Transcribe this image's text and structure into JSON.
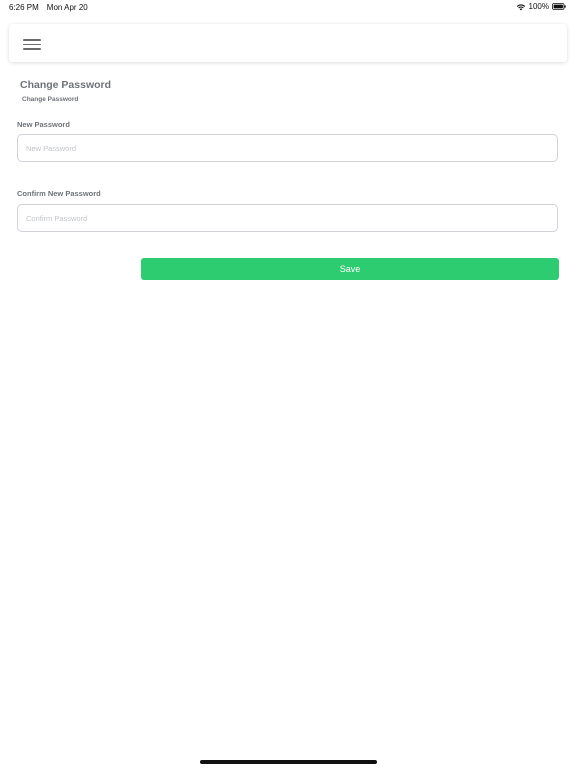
{
  "status_bar": {
    "time": "6:26 PM",
    "date": "Mon Apr 20",
    "battery_percent": "100%",
    "icons": [
      "wifi-icon",
      "battery-icon"
    ]
  },
  "header": {
    "menu_icon": "hamburger-menu-icon"
  },
  "page": {
    "title": "Change Password",
    "breadcrumb": "Change Password"
  },
  "form": {
    "new_password": {
      "label": "New Password",
      "value": "",
      "placeholder": "New Password"
    },
    "confirm_password": {
      "label": "Confirm New Password",
      "value": "",
      "placeholder": "Confirm Password"
    },
    "save_label": "Save"
  },
  "colors": {
    "accent": "#2ecc71",
    "label_text": "#6e7378",
    "input_border": "#cfd3d7",
    "placeholder": "#c2c5c9"
  }
}
